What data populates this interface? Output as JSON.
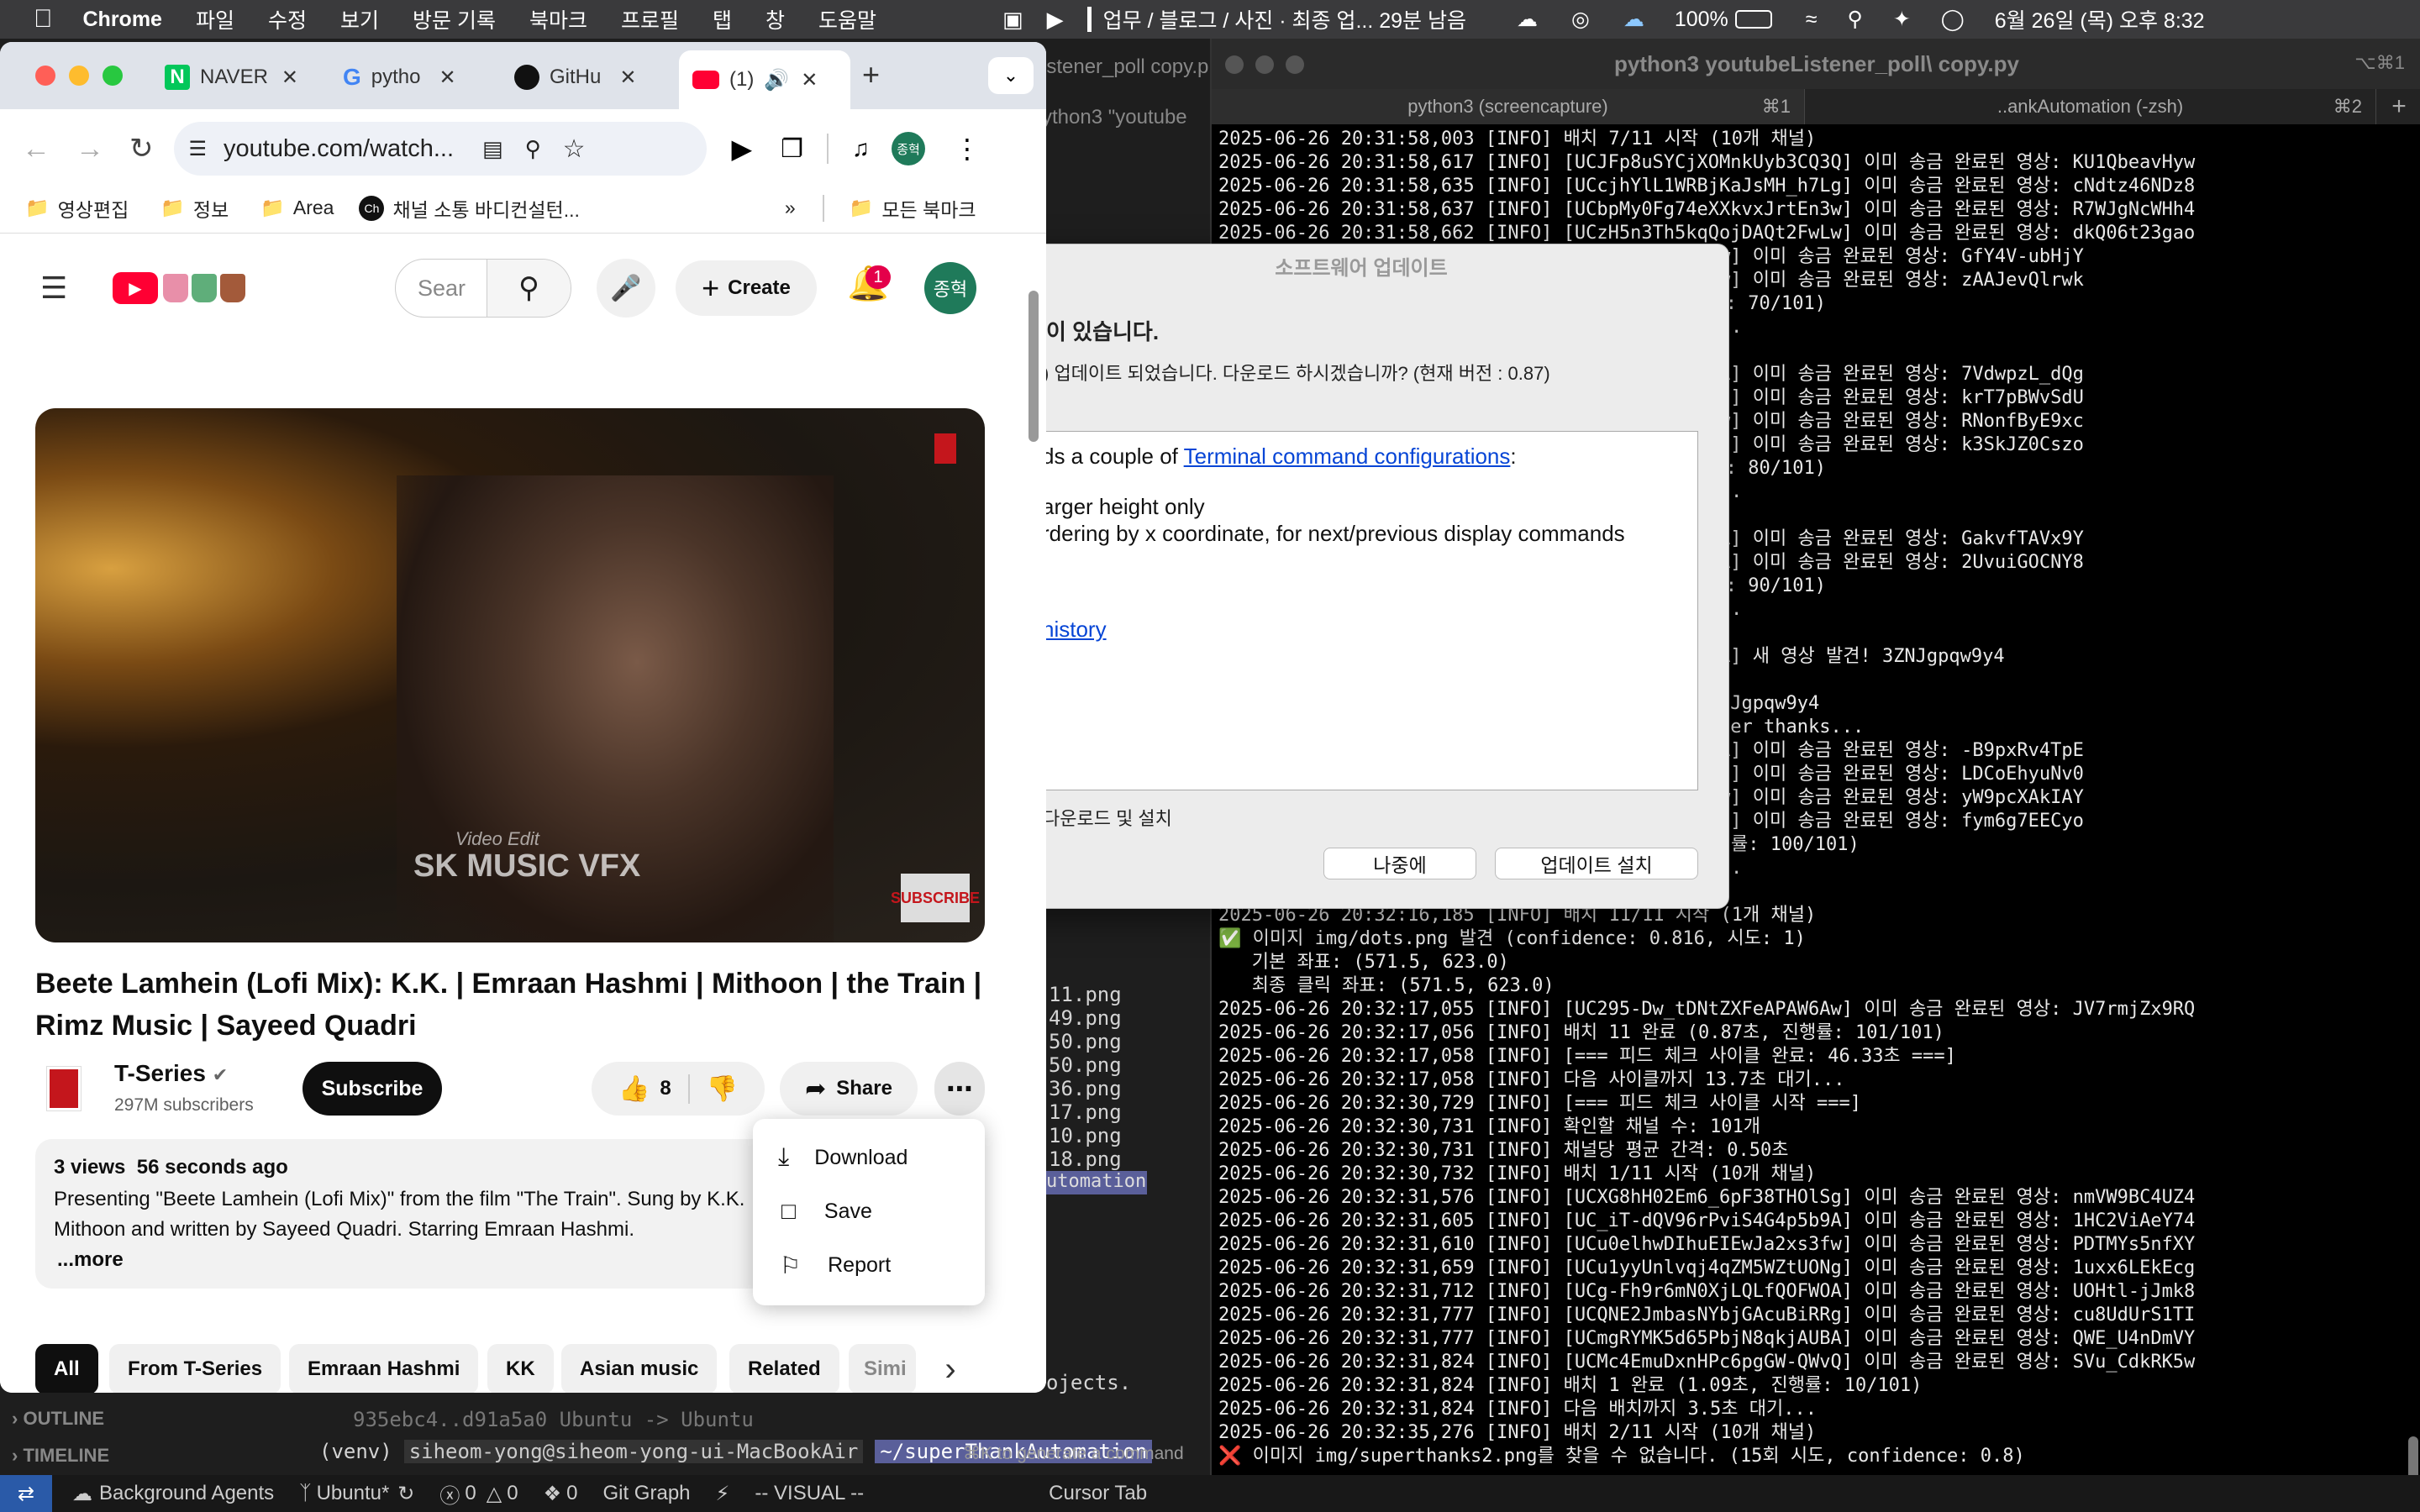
{
  "menubar": {
    "app": "Chrome",
    "items": [
      "파일",
      "수정",
      "보기",
      "방문 기록",
      "북마크",
      "프로필",
      "탭",
      "창",
      "도움말"
    ],
    "status_text": "업무 / 블로그 / 사진 · 최종 업... 29분 남음",
    "battery": "100%",
    "datetime": "6월 26일 (목) 오후 8:32"
  },
  "chrome": {
    "tabs": [
      "NAVER",
      "pytho",
      "GitHu",
      "(1)"
    ],
    "url": "youtube.com/watch...",
    "profile_initial": "종혁",
    "bookmarks": [
      "영상편집",
      "정보",
      "Area",
      "채널 소통 바디컨설턴...",
      "모든 북마크"
    ]
  },
  "youtube": {
    "search_placeholder": "Sear",
    "create_label": "Create",
    "notification_count": "1",
    "avatar_initial": "종혁",
    "watermark_small": "Video Edit",
    "watermark_big": "SK MUSIC VFX",
    "subscribe_badge": "SUBSCRIBE",
    "title_line1": "Beete Lamhein (Lofi Mix): K.K. | Emraan Hashmi | Mithoon | the Train |",
    "title_line2": "Rimz Music | Sayeed Quadri",
    "channel": "T-Series",
    "subscribers": "297M subscribers",
    "subscribe": "Subscribe",
    "likes": "8",
    "share": "Share",
    "views": "3 views",
    "age": "56 seconds ago",
    "desc_line1": "Presenting \"Beete Lamhein (Lofi Mix)\" from the film \"The Train\". Sung by K.K.",
    "desc_line2": "Mithoon and written by Sayeed Quadri. Starring Emraan Hashmi.",
    "more": "...more",
    "menu": [
      "Download",
      "Save",
      "Report"
    ],
    "chips": [
      "All",
      "From T-Series",
      "Emraan Hashmi",
      "KK",
      "Asian music",
      "Related",
      "Simi"
    ]
  },
  "dialog": {
    "title": "소프트웨어 업데이트",
    "heading": "이 있습니다.",
    "subtitle": ") 업데이트 되었습니다. 다운로드 하시겠습니까? (현재 버전 : 0.87)",
    "body_prefix": "ds a couple of ",
    "body_link": "Terminal command configurations",
    "body_suffix": ":",
    "line2": "arger height only",
    "line3": "rdering by x coordinate, for next/previous display commands",
    "history_link": "history",
    "auto_download": "다운로드 및 설치",
    "later": "나중에",
    "install": "업데이트 설치"
  },
  "editor": {
    "lines": [
      "11.png",
      "49.png",
      "50.png",
      "50.png",
      "36.png",
      "17.png",
      "10.png",
      "18.png"
    ],
    "tab_label": "utomation",
    "objects_line": "ojects.",
    "hash_line": "935ebc4..d91a5a0  Ubuntu -> Ubuntu",
    "prompt_venv": "(venv)",
    "prompt_user": "siheom-yong@siheom-yong-ui-MacBookAir",
    "prompt_path": "~/superThankAutomation",
    "outline": "OUTLINE",
    "timeline": "TIMELINE",
    "cmdk": "⌘K to generate a command",
    "top_tab": "istener_poll copy.p",
    "top_cmd": "ython3 \"youtube"
  },
  "terminal": {
    "title": "python3 youtubeListener_poll\\ copy.py",
    "shortcut": "⌥⌘1",
    "tab1": "python3 (screencapture)",
    "tab1_key": "⌘1",
    "tab2": "..ankAutomation (-zsh)",
    "tab2_key": "⌘2",
    "lines": [
      "2025-06-26 20:31:58,003 [INFO] 배치 7/11 시작 (10개 채널)",
      "2025-06-26 20:31:58,617 [INFO] [UCJFp8uSYCjXOMnkUyb3CQ3Q] 이미 송금 완료된 영상: KU1QbeavHyw",
      "2025-06-26 20:31:58,635 [INFO] [UCcjhYlL1WRBjKaJsMH_h7Lg] 이미 송금 완료된 영상: cNdtz46NDz8",
      "2025-06-26 20:31:58,637 [INFO] [UCbpMy0Fg74eXXkvxJrtEn3w] 이미 송금 완료된 영상: R7WJgNcWHh4",
      "2025-06-26 20:31:58,662 [INFO] [UCzH5n3Th5kqQojDAQt2FwLw] 이미 송금 완료된 영상: dkQ06t23gao",
      "                                         32UEw] 이미 송금 완료된 영상: GfY4V-ubHjY",
      "                                         STQNw] 이미 송금 완료된 영상: zAAJevQlrwk",
      "                                         진행률: 70/101)",
      "                                         대기...",
      "                                         채널)",
      "                                         5CYPA] 이미 송금 완료된 영상: 7VdwpzL_dQg",
      "                                         VBKvQ] 이미 송금 완료된 영상: krT7pBWvSdU",
      "                                         0Tunw] 이미 송금 완료된 영상: RNonfByE9xc",
      "                                         a4tdg] 이미 송금 완료된 영상: k3SkJZ0Cszo",
      "                                         진행률: 80/101)",
      "                                         대기...",
      "                                         채널)",
      "                                         waiBA] 이미 송금 완료된 영상: GakvfTAVx9Y",
      "                                         yjudA] 이미 송금 완료된 영상: 2UvuiGOCNY8",
      "                                         진행률: 90/101)",
      "                                         대기...",
      "                                         채널)",
      "                                         4_brA] 새 영상 발견! 3ZNJgpqw9y4",
      "                                         시작",
      "                                         : 3ZNJgpqw9y4",
      "                                         g super thanks...",
      "                                         ms2LA] 이미 송금 완료된 영상: -B9pxRv4TpE",
      "                                         AHD7Q] 이미 송금 완료된 영상: LDCoEhyuNv0",
      "                                         JbuZw] 이미 송금 완료된 영상: yW9pcXAkIAY",
      "                                         u57UQ] 이미 송금 완료된 영상: fym6g7EECyo",
      "                                         , 진행률: 100/101)",
      "                                         대기...",
      "",
      "2025-06-26 20:32:16,185 [INFO] 배치 11/11 시작 (1개 채널)",
      "✅ 이미지 img/dots.png 발견 (confidence: 0.816, 시도: 1)",
      "   기본 좌표: (571.5, 623.0)",
      "   최종 클릭 좌표: (571.5, 623.0)",
      "2025-06-26 20:32:17,055 [INFO] [UC295-Dw_tDNtZXFeAPAW6Aw] 이미 송금 완료된 영상: JV7rmjZx9RQ",
      "2025-06-26 20:32:17,056 [INFO] 배치 11 완료 (0.87초, 진행률: 101/101)",
      "2025-06-26 20:32:17,058 [INFO] [=== 피드 체크 사이클 완료: 46.33초 ===]",
      "2025-06-26 20:32:17,058 [INFO] 다음 사이클까지 13.7초 대기...",
      "2025-06-26 20:32:30,729 [INFO] [=== 피드 체크 사이클 시작 ===]",
      "2025-06-26 20:32:30,731 [INFO] 확인할 채널 수: 101개",
      "2025-06-26 20:32:30,731 [INFO] 채널당 평균 간격: 0.50초",
      "2025-06-26 20:32:30,732 [INFO] 배치 1/11 시작 (10개 채널)",
      "2025-06-26 20:32:31,576 [INFO] [UCXG8hH02Em6_6pF38THOlSg] 이미 송금 완료된 영상: nmVW9BC4UZ4",
      "2025-06-26 20:32:31,605 [INFO] [UC_iT-dQV96rPviS4G4p5b9A] 이미 송금 완료된 영상: 1HC2ViAeY74",
      "2025-06-26 20:32:31,610 [INFO] [UCu0elhwDIhuEIEwJa2xs3fw] 이미 송금 완료된 영상: PDTMYs5nfXY",
      "2025-06-26 20:32:31,659 [INFO] [UCu1yyUnlvqj4qZM5WZtUONg] 이미 송금 완료된 영상: 1uxx6LEkEcg",
      "2025-06-26 20:32:31,712 [INFO] [UCg-Fh9r6mN0XjLQLfQOFWOA] 이미 송금 완료된 영상: UOHtl-jJmk8",
      "2025-06-26 20:32:31,777 [INFO] [UCQNE2JmbasNYbjGAcuBiRRg] 이미 송금 완료된 영상: cu8UdUrS1TI",
      "2025-06-26 20:32:31,777 [INFO] [UCmgRYMK5d65PbjN8qkjAUBA] 이미 송금 완료된 영상: QWE_U4nDmVY",
      "2025-06-26 20:32:31,824 [INFO] [UCMc4EmuDxnHPc6pgGW-QWvQ] 이미 송금 완료된 영상: SVu_CdkRK5w",
      "2025-06-26 20:32:31,824 [INFO] 배치 1 완료 (1.09초, 진행률: 10/101)",
      "2025-06-26 20:32:31,824 [INFO] 다음 배치까지 3.5초 대기...",
      "2025-06-26 20:32:35,276 [INFO] 배치 2/11 시작 (10개 채널)",
      "❌ 이미지 img/superthanks2.png를 찾을 수 없습니다. (15회 시도, confidence: 0.8)"
    ]
  },
  "statusbar": {
    "agents": "Background Agents",
    "branch": "Ubuntu*",
    "errors": "0",
    "warnings": "0",
    "ports": "0",
    "git": "Git Graph",
    "mode": "-- VISUAL --",
    "cursor_tab": "Cursor Tab"
  },
  "colors": {
    "youtube_red": "#ff0033",
    "accent_green": "#1f7a5a",
    "link_blue": "#0645d6",
    "terminal_bg": "#000000"
  }
}
